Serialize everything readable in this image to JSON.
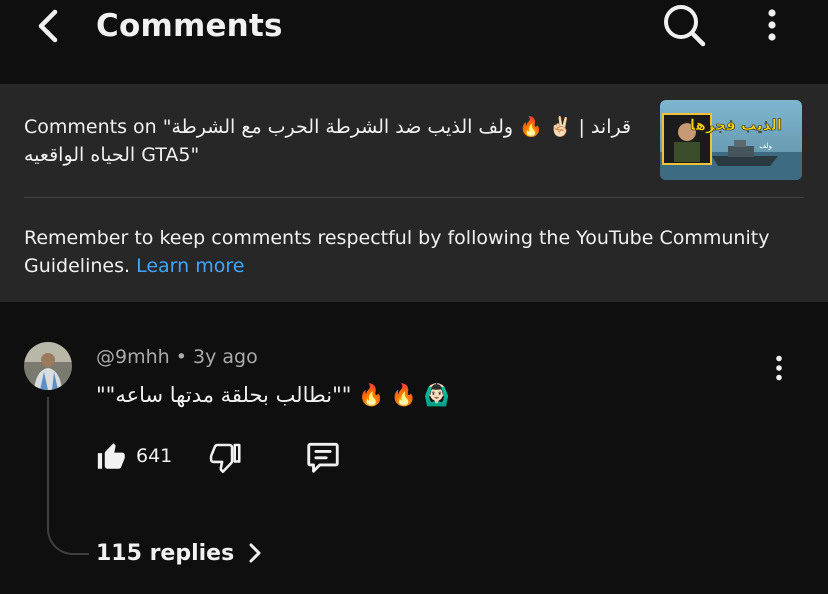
{
  "header": {
    "title": "Comments",
    "icons": [
      "chevron-left-icon",
      "search-icon",
      "more-vert-icon"
    ]
  },
  "video": {
    "comments_on": "Comments on \"قراند | ✌🏻 🔥 ولف الذيب ضد الشرطة الحرب مع الشرطة الحياه الواقعيه GTA5\"",
    "thumbnail_text": "الذيب فجرها",
    "thumbnail_sub": "ولف"
  },
  "guidelines": {
    "text": "Remember to keep comments respectful by following the YouTube Community Guidelines.",
    "link": "Learn more"
  },
  "comment": {
    "author": "@9mhh",
    "separator": "•",
    "time": "3y ago",
    "text": "\"\"نطالب بحلقة مدتها ساعه\"\" 🔥 🔥 🙆🏻‍♂️",
    "likes": "641",
    "replies": "115 replies"
  },
  "colors": {
    "background": "#0f0f0f",
    "panel": "#272727",
    "link": "#3ea6ff",
    "secondary_text": "#aaaaaa"
  }
}
